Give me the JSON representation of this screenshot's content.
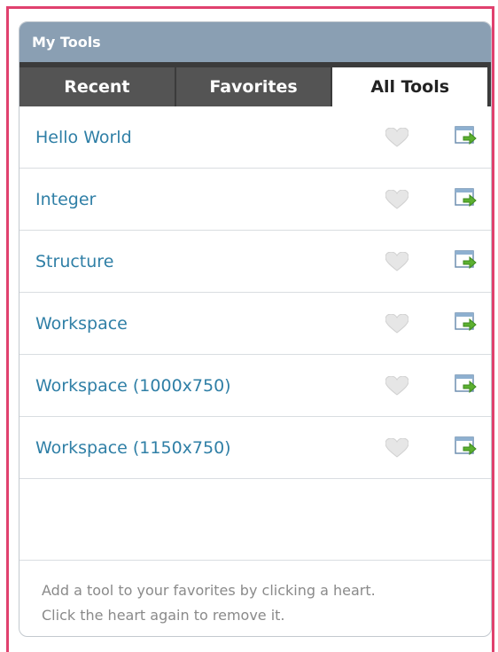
{
  "widget": {
    "title": "My Tools"
  },
  "tabs": [
    {
      "label": "Recent",
      "active": false
    },
    {
      "label": "Favorites",
      "active": false
    },
    {
      "label": "All Tools",
      "active": true
    }
  ],
  "tools": [
    {
      "label": "Hello World"
    },
    {
      "label": "Integer"
    },
    {
      "label": "Structure"
    },
    {
      "label": "Workspace"
    },
    {
      "label": "Workspace (1000x750)"
    },
    {
      "label": "Workspace (1150x750)"
    }
  ],
  "footer": {
    "line1": "Add a tool to your favorites by clicking a heart.",
    "line2": "Click the heart again to remove it."
  },
  "colors": {
    "frame": "#e0416e",
    "title_bar": "#8a9fb3",
    "link": "#2f7fa6"
  },
  "icons": {
    "favorite": "heart-icon",
    "launch": "launch-window-icon"
  }
}
